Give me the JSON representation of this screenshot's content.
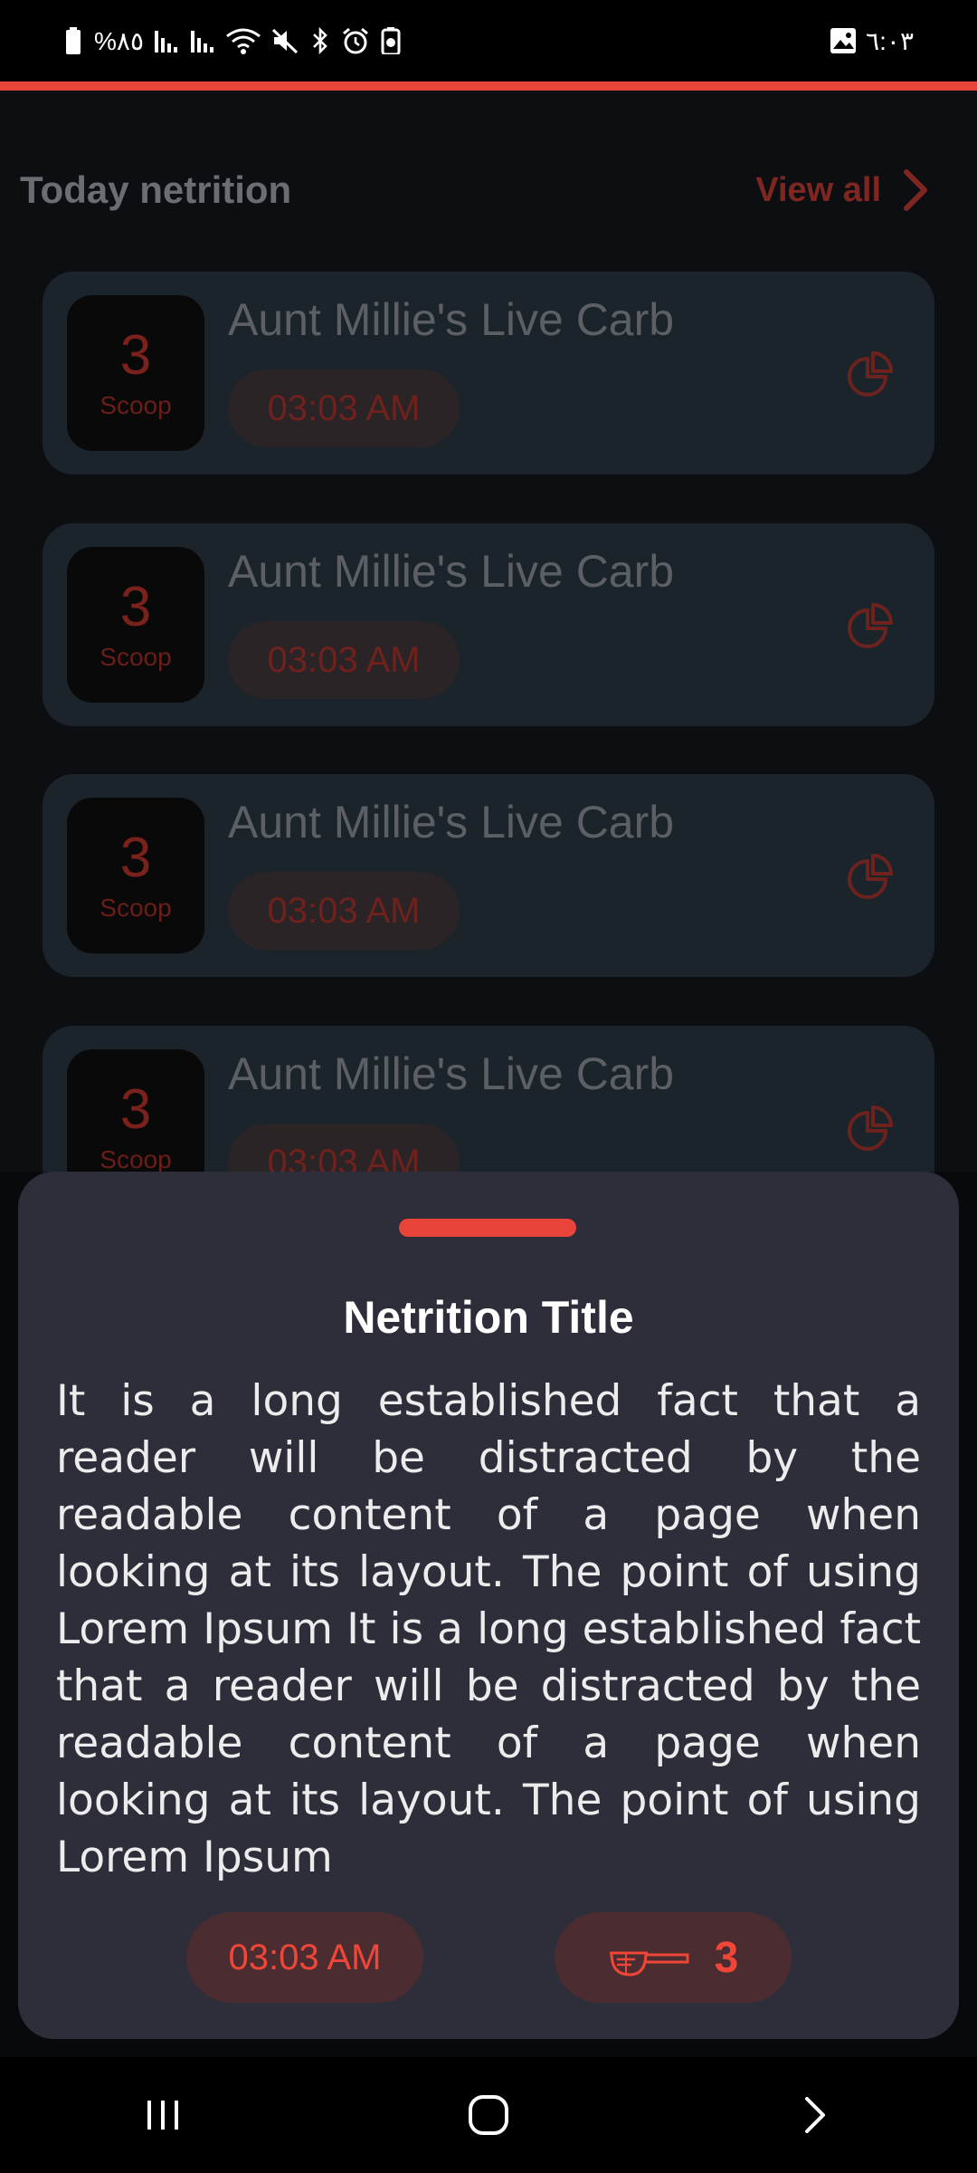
{
  "status_bar": {
    "left_text": "%٨٥",
    "time": "٦:٠٣",
    "left_icons": [
      "battery-icon",
      "signal-icon",
      "signal-icon",
      "wifi-icon",
      "mute-icon",
      "bluetooth-icon",
      "alarm-icon",
      "battery-saver-icon"
    ],
    "right_icons": [
      "gallery-icon"
    ]
  },
  "colors": {
    "accent": "#e8443a",
    "background": "#0d0e12",
    "card": "#1c242b",
    "sheet": "#2d2e3a"
  },
  "section": {
    "title": "Today netrition",
    "view_all": "View all"
  },
  "cards": [
    {
      "qty": "3",
      "unit": "Scoop",
      "title": "Aunt Millie's Live Carb",
      "time": "03:03 AM"
    },
    {
      "qty": "3",
      "unit": "Scoop",
      "title": "Aunt Millie's Live Carb",
      "time": "03:03 AM"
    },
    {
      "qty": "3",
      "unit": "Scoop",
      "title": "Aunt Millie's Live Carb",
      "time": "03:03 AM"
    },
    {
      "qty": "3",
      "unit": "Scoop",
      "title": "Aunt Millie's Live Carb",
      "time": "03:03 AM"
    }
  ],
  "sheet": {
    "title": "Netrition Title",
    "body": "It is a long established fact that a reader will be distracted by the readable content of a page when looking at its layout. The point of using Lorem Ipsum It is a long established fact that a reader will be distracted by the readable content of a page when looking at its layout. The point of using Lorem Ipsum",
    "time": "03:03 AM",
    "qty": "3"
  },
  "nav": {
    "icons": [
      "recent-apps-icon",
      "home-icon",
      "back-icon"
    ]
  }
}
